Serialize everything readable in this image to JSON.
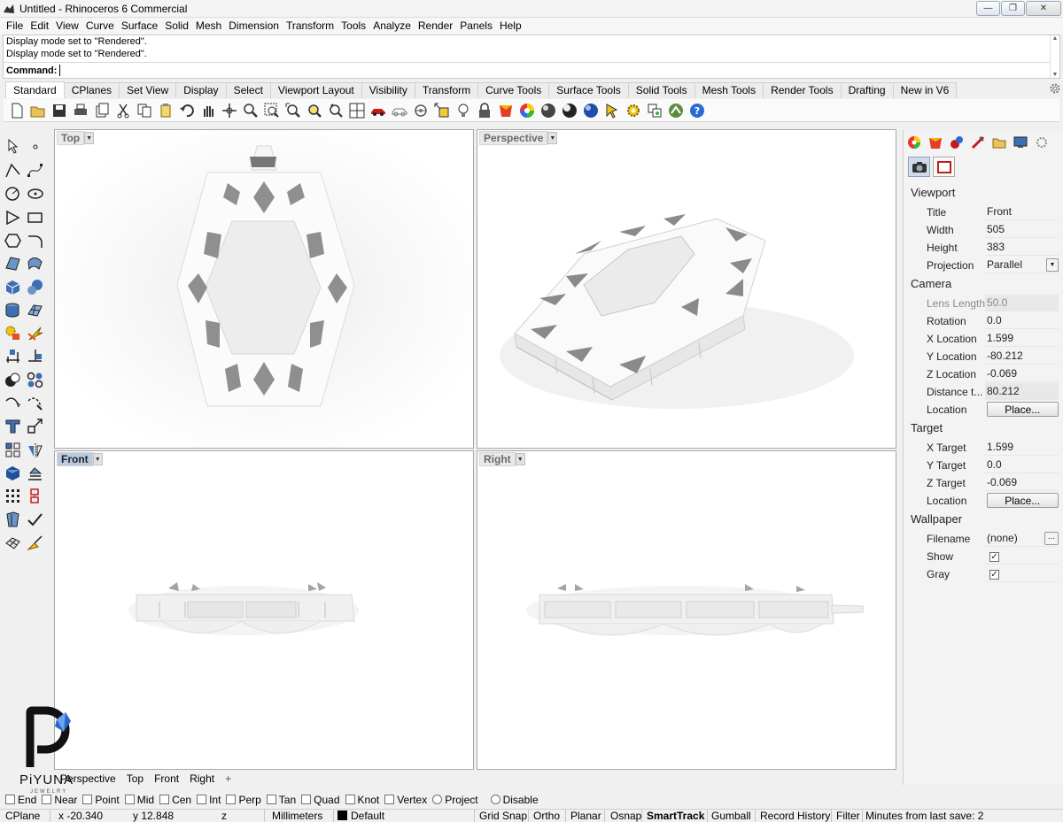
{
  "window": {
    "title": "Untitled - Rhinoceros 6 Commercial"
  },
  "menu": [
    "File",
    "Edit",
    "View",
    "Curve",
    "Surface",
    "Solid",
    "Mesh",
    "Dimension",
    "Transform",
    "Tools",
    "Analyze",
    "Render",
    "Panels",
    "Help"
  ],
  "command": {
    "history": [
      "Display mode set to \"Rendered\".",
      "Display mode set to \"Rendered\"."
    ],
    "prompt": "Command:"
  },
  "toolbar_tabs": [
    "Standard",
    "CPlanes",
    "Set View",
    "Display",
    "Select",
    "Viewport Layout",
    "Visibility",
    "Transform",
    "Curve Tools",
    "Surface Tools",
    "Solid Tools",
    "Mesh Tools",
    "Render Tools",
    "Drafting",
    "New in V6"
  ],
  "toolbar_icons": [
    "new-icon",
    "open-icon",
    "save-icon",
    "print-icon",
    "import-icon",
    "cut-icon",
    "copy-icon",
    "paste-icon",
    "undo-icon",
    "pan-icon",
    "rotate-view-icon",
    "zoom-icon",
    "zoom-window-icon",
    "zoom-extents-icon",
    "zoom-selected-icon",
    "rotate-icon",
    "four-viewports-icon",
    "car-icon",
    "wireframe-icon",
    "ghosted-icon",
    "select-icon",
    "light-icon",
    "lock-icon",
    "layer-icon",
    "color-wheel-icon",
    "material-icon",
    "render-sphere-icon",
    "render-icon",
    "cursor-icon",
    "settings-gear-icon",
    "options-icon",
    "grasshopper-icon",
    "help-icon"
  ],
  "viewports": [
    {
      "name": "Top",
      "active": false
    },
    {
      "name": "Perspective",
      "active": false
    },
    {
      "name": "Front",
      "active": true
    },
    {
      "name": "Right",
      "active": false
    }
  ],
  "panel": {
    "sections": {
      "viewport": "Viewport",
      "camera": "Camera",
      "target": "Target",
      "wallpaper": "Wallpaper"
    },
    "viewport_props": [
      {
        "key": "Title",
        "value": "Front"
      },
      {
        "key": "Width",
        "value": "505"
      },
      {
        "key": "Height",
        "value": "383"
      },
      {
        "key": "Projection",
        "value": "Parallel"
      }
    ],
    "camera_props": [
      {
        "key": "Lens Length",
        "value": "50.0"
      },
      {
        "key": "Rotation",
        "value": "0.0"
      },
      {
        "key": "X Location",
        "value": "1.599"
      },
      {
        "key": "Y Location",
        "value": "-80.212"
      },
      {
        "key": "Z Location",
        "value": "-0.069"
      },
      {
        "key": "Distance t...",
        "value": "80.212"
      },
      {
        "key": "Location",
        "value": "Place..."
      }
    ],
    "target_props": [
      {
        "key": "X Target",
        "value": "1.599"
      },
      {
        "key": "Y Target",
        "value": "0.0"
      },
      {
        "key": "Z Target",
        "value": "-0.069"
      },
      {
        "key": "Location",
        "value": "Place..."
      }
    ],
    "wallpaper_props": [
      {
        "key": "Filename",
        "value": "(none)"
      },
      {
        "key": "Show",
        "value": "checked"
      },
      {
        "key": "Gray",
        "value": "checked"
      }
    ]
  },
  "viewport_tabs": [
    "Perspective",
    "Top",
    "Front",
    "Right",
    "+"
  ],
  "osnaps": [
    "End",
    "Near",
    "Point",
    "Mid",
    "Cen",
    "Int",
    "Perp",
    "Tan",
    "Quad",
    "Knot",
    "Vertex",
    "Project",
    "Disable"
  ],
  "status": {
    "cplane": "CPlane",
    "x": "x -20.340",
    "y": "y 12.848",
    "z": "z",
    "units": "Millimeters",
    "layer": "Default",
    "grid_snap": "Grid Snap",
    "ortho": "Ortho",
    "planar": "Planar",
    "osnap": "Osnap",
    "smarttrack": "SmartTrack",
    "gumball": "Gumball",
    "record_history": "Record History",
    "filter": "Filter",
    "save_status": "Minutes from last save: 2"
  },
  "watermark": {
    "brand": "PiYUNA",
    "sub": "JEWELRY"
  }
}
